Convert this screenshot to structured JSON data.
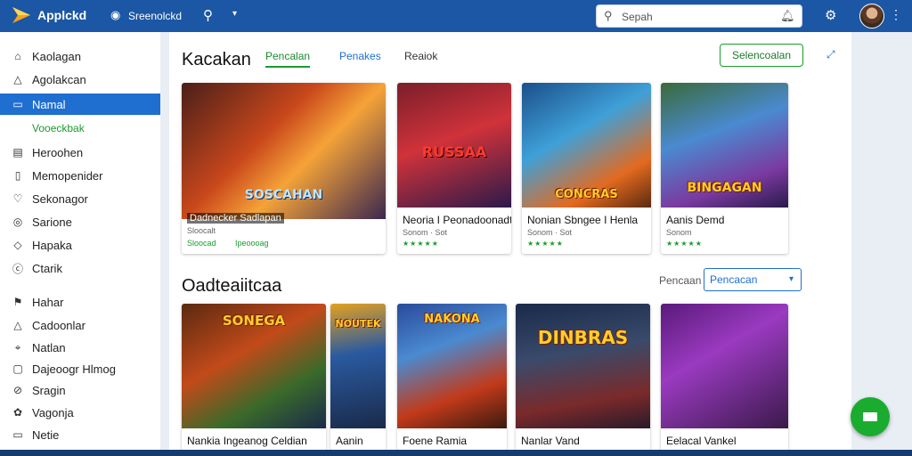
{
  "app": {
    "name": "Applckd",
    "nav_label": "Sreenolckd",
    "search_placeholder": "Sepah"
  },
  "sidebar": {
    "items": [
      {
        "icon": "home-icon",
        "label": "Kaolagan"
      },
      {
        "icon": "apps-icon",
        "label": "Agolakcan"
      },
      {
        "icon": "window-icon",
        "label": "Namal"
      },
      {
        "icon": "list-icon",
        "label": "Heroohen"
      },
      {
        "icon": "bookmark-icon",
        "label": "Memopenider"
      },
      {
        "icon": "heart-icon",
        "label": "Sekonagor"
      },
      {
        "icon": "gamepad-icon",
        "label": "Sarione"
      },
      {
        "icon": "tag-icon",
        "label": "Hapaka"
      },
      {
        "icon": "info-icon",
        "label": "Ctarik"
      },
      {
        "icon": "flag-icon",
        "label": "Hahar"
      },
      {
        "icon": "bell-icon",
        "label": "Cadoonlar"
      },
      {
        "icon": "pin-icon",
        "label": "Natlan"
      },
      {
        "icon": "chat-icon",
        "label": "Dajeoogr Hlmog"
      },
      {
        "icon": "link-icon",
        "label": "Sragin"
      },
      {
        "icon": "settings-icon",
        "label": "Vagonja"
      },
      {
        "icon": "card-icon",
        "label": "Netie"
      }
    ],
    "active_sub": "Vooeckbak"
  },
  "main": {
    "section1_title": "Kacakan",
    "tabs": [
      "Pencalan",
      "Penakes",
      "Reaiok"
    ],
    "primary_button": "Selencoalan",
    "section2_title": "Oadteaiitcaa",
    "sort_label": "Pencaan",
    "sort_value": "Pencacan",
    "cards_row1": [
      {
        "art_text": "SOSCAHAN",
        "title": "Dadnecker Sadlapan",
        "sub1": "Sloocalt",
        "sub2": "Sloocad",
        "sub3": "Ipeoooag",
        "stars": "★★★★★"
      },
      {
        "art_text": "RUSSAA",
        "title": "Neoria I Peonadoonadt",
        "sub": "Sonom · Sot",
        "stars": "★★★★★"
      },
      {
        "art_text": "CONCRAS",
        "title": "Nonian Sbngee I Henla",
        "sub": "Sonom · Sot",
        "stars": "★★★★★"
      },
      {
        "art_text": "BINGAGAN",
        "title": "Aanis Demd",
        "sub": "Sonom",
        "stars": "★★★★★"
      }
    ],
    "cards_row2": [
      {
        "art_text": "SONEGA",
        "title": "Nankia Ingeanog Celdian"
      },
      {
        "art_text": "NOUTEK",
        "title": "Aanin"
      },
      {
        "art_text": "NAKONA",
        "title": "Foene Ramia"
      },
      {
        "art_text": "DINBRAS",
        "title": "Nanlar Vand"
      },
      {
        "art_text": "",
        "title": "Eelacal Vankel"
      }
    ]
  },
  "colors": {
    "topbar": "#1c57a5",
    "accent_green": "#1a9c2e",
    "accent_blue": "#1f6fd1"
  }
}
